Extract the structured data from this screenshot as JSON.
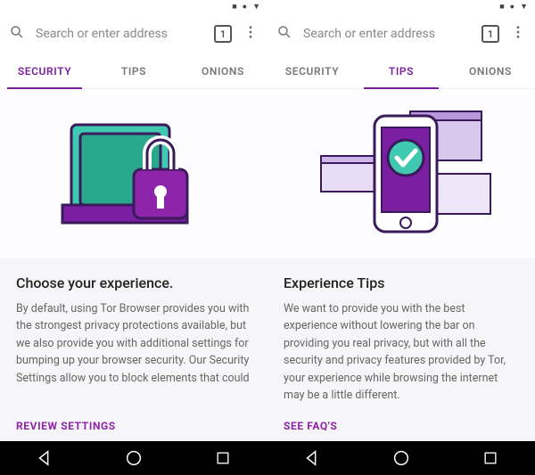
{
  "status_icons": [
    "■",
    "●",
    "▼"
  ],
  "toolbar": {
    "search_placeholder": "Search or enter address",
    "tab_count": "1"
  },
  "tabs": [
    "SECURITY",
    "TIPS",
    "ONIONS"
  ],
  "screens": [
    {
      "active_tab": 0,
      "heading": "Choose your experience.",
      "body": "By default, using Tor Browser provides you with the strongest privacy protections available, but we also provide you with additional settings for bumping up your browser security. Our Security Settings allow you to block elements that could",
      "cta": "REVIEW SETTINGS"
    },
    {
      "active_tab": 1,
      "heading": "Experience Tips",
      "body": "We want to provide you with the best experience without lowering the bar on providing you real privacy, but with all the security and privacy features provided by Tor, your experience while browsing the internet may be a little different.",
      "cta": "SEE FAQ'S"
    }
  ],
  "colors": {
    "accent": "#7b1fa2"
  }
}
